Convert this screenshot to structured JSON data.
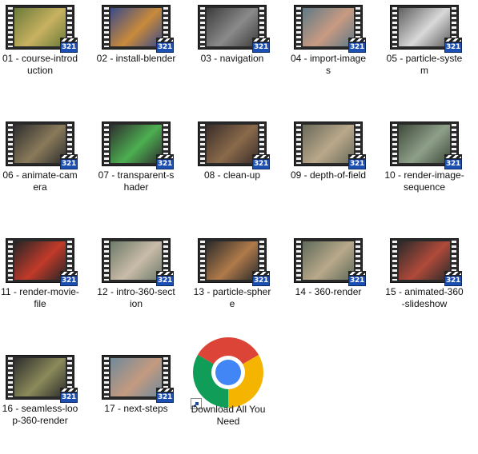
{
  "folder": {
    "items": [
      {
        "label": "01 - course-introduction",
        "frame": "#6b7a3a",
        "accent": "#c7b160"
      },
      {
        "label": "02 - install-blender",
        "frame": "#3a4a8a",
        "accent": "#c98a3a"
      },
      {
        "label": "03 - navigation",
        "frame": "#3c3c3c",
        "accent": "#8a8a8a"
      },
      {
        "label": "04 - import-images",
        "frame": "#5f7a86",
        "accent": "#c89a82"
      },
      {
        "label": "05 - particle-system",
        "frame": "#5f5f5f",
        "accent": "#d9d9d9"
      },
      {
        "label": "06 - animate-camera",
        "frame": "#2e2e2e",
        "accent": "#8a7a5a"
      },
      {
        "label": "07 - transparent-shader",
        "frame": "#2f2f2f",
        "accent": "#4caf50"
      },
      {
        "label": "08 - clean-up",
        "frame": "#3a2d2a",
        "accent": "#8a6a4a"
      },
      {
        "label": "09 - depth-of-field",
        "frame": "#6a6a5a",
        "accent": "#b9a88a"
      },
      {
        "label": "10 - render-image-sequence",
        "frame": "#3e4a3a",
        "accent": "#8fa08a"
      },
      {
        "label": "11 - render-movie-file",
        "frame": "#252525",
        "accent": "#c23a2a"
      },
      {
        "label": "12 - intro-360-section",
        "frame": "#6d7a6a",
        "accent": "#c9bca8"
      },
      {
        "label": "13 - particle-sphere",
        "frame": "#2b2b2b",
        "accent": "#b07a4a"
      },
      {
        "label": "14 - 360-render",
        "frame": "#5f6a5a",
        "accent": "#b9a98a"
      },
      {
        "label": "15 - animated-360-slideshow",
        "frame": "#2a2a2a",
        "accent": "#b04a3a"
      },
      {
        "label": "16 - seamless-loop-360-render",
        "frame": "#2d2d2d",
        "accent": "#8a8a5a"
      },
      {
        "label": "17 - next-steps",
        "frame": "#6f8a9a",
        "accent": "#c49a80"
      }
    ],
    "badge_text": "321",
    "shortcut": {
      "label": "Download All You Need",
      "icon": "chrome-icon"
    }
  },
  "colors": {
    "chrome_red": "#db4437",
    "chrome_yellow": "#f4b400",
    "chrome_green": "#0f9d58",
    "chrome_blue": "#4285f4"
  }
}
